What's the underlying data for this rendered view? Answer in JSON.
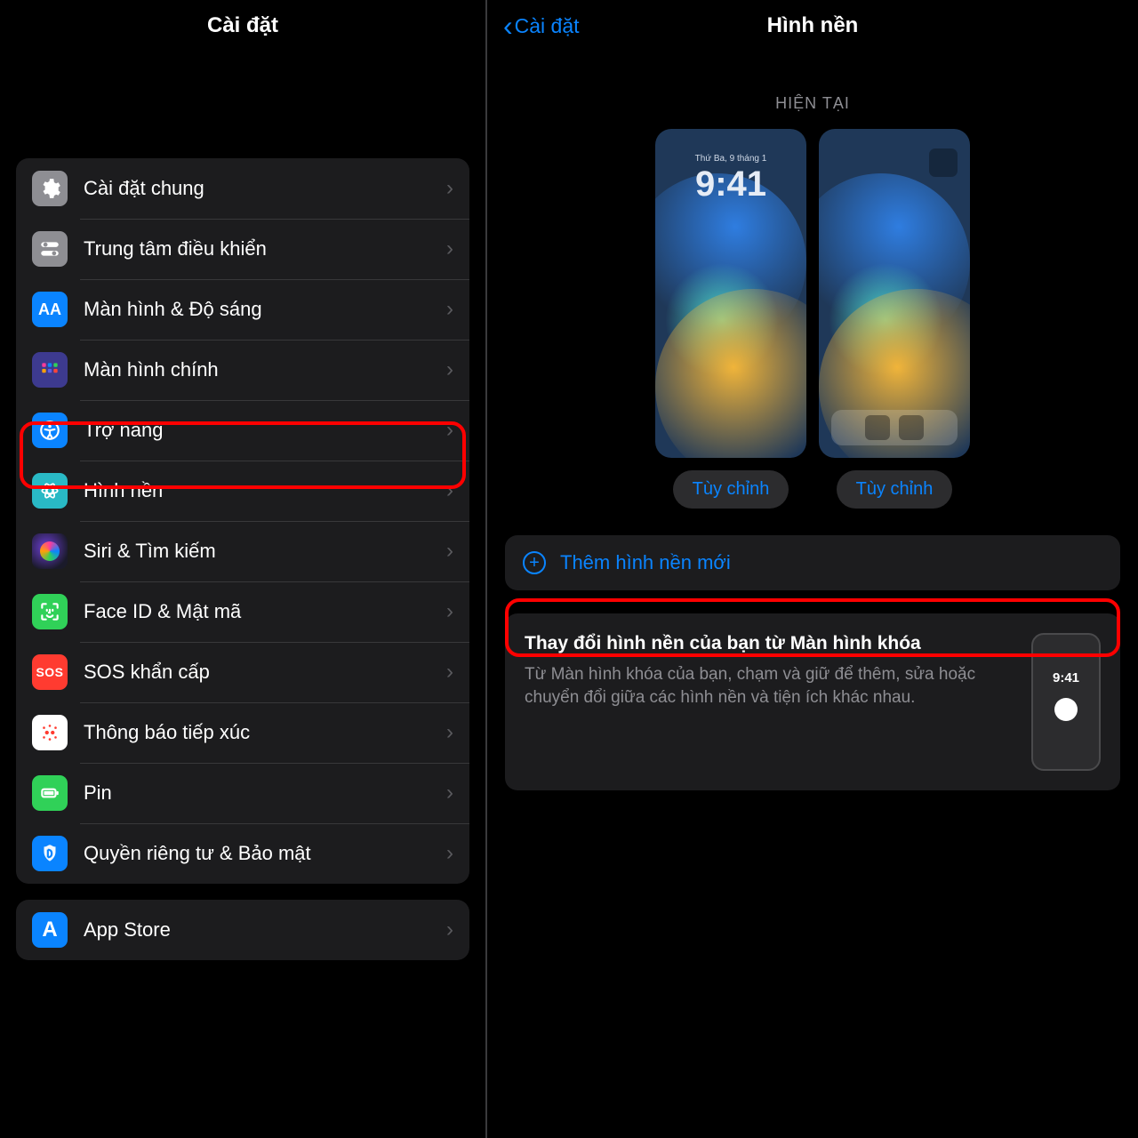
{
  "left": {
    "title": "Cài đặt",
    "items": [
      {
        "label": "Cài đặt chung",
        "icon": "gear-icon"
      },
      {
        "label": "Trung tâm điều khiển",
        "icon": "control-center-icon"
      },
      {
        "label": "Màn hình & Độ sáng",
        "icon": "display-icon"
      },
      {
        "label": "Màn hình chính",
        "icon": "home-screen-icon"
      },
      {
        "label": "Trợ năng",
        "icon": "accessibility-icon"
      },
      {
        "label": "Hình nền",
        "icon": "wallpaper-icon"
      },
      {
        "label": "Siri & Tìm kiếm",
        "icon": "siri-icon"
      },
      {
        "label": "Face ID & Mật mã",
        "icon": "faceid-icon"
      },
      {
        "label": "SOS khẩn cấp",
        "icon": "sos-icon"
      },
      {
        "label": "Thông báo tiếp xúc",
        "icon": "exposure-icon"
      },
      {
        "label": "Pin",
        "icon": "battery-icon"
      },
      {
        "label": "Quyền riêng tư & Bảo mật",
        "icon": "privacy-icon"
      }
    ],
    "next_group_item": {
      "label": "App Store",
      "icon": "appstore-icon"
    }
  },
  "right": {
    "back": "Cài đặt",
    "title": "Hình nền",
    "current_header": "HIỆN TẠI",
    "lock_date": "Thứ Ba, 9 tháng 1",
    "lock_time": "9:41",
    "customize": "Tùy chỉnh",
    "add_new": "Thêm hình nền mới",
    "tip_title": "Thay đổi hình nền của bạn từ Màn hình khóa",
    "tip_body": "Từ Màn hình khóa của bạn, chạm và giữ để thêm, sửa hoặc chuyển đổi giữa các hình nền và tiện ích khác nhau.",
    "tip_time": "9:41"
  },
  "colors": {
    "accent": "#0a84ff",
    "highlight": "#ff0000"
  }
}
